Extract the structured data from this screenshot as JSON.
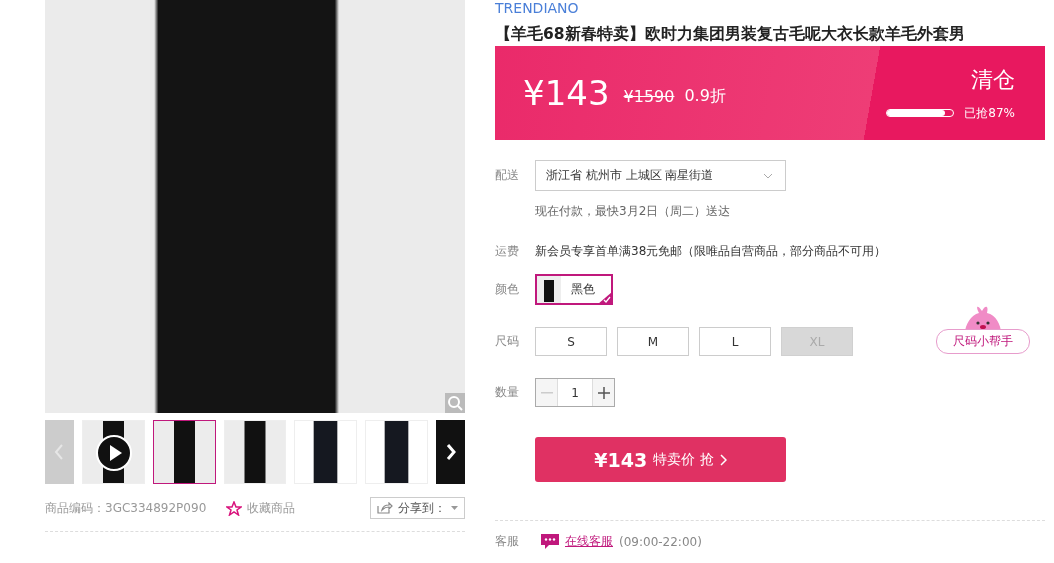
{
  "gallery": {
    "thumbnails": [
      {
        "kind": "video",
        "selected": false
      },
      {
        "kind": "photo",
        "selected": true
      },
      {
        "kind": "photo",
        "selected": false
      },
      {
        "kind": "product",
        "selected": false
      },
      {
        "kind": "product",
        "selected": false
      }
    ],
    "product_code": "商品编码：3GC334892P090",
    "favorite": "收藏商品",
    "share": "分享到："
  },
  "brand": "TRENDIANO",
  "title": "【羊毛68新春特卖】欧时力集团男装复古毛呢大衣长款羊毛外套男",
  "price_banner": {
    "price": "¥143",
    "original_price": "¥1590",
    "discount": "0.9折",
    "badge": "清仓",
    "level": 0.87,
    "sold": "已抢87%"
  },
  "delivery": {
    "label": "配送",
    "address": "浙江省 杭州市 上城区 南星街道",
    "note": "现在付款，最快3月2日（周二）送达"
  },
  "shipping": {
    "label": "运费",
    "text": "新会员专享首单满38元免邮（限唯品自营商品，部分商品不可用）"
  },
  "color": {
    "label": "颜色",
    "options": [
      {
        "label": "黑色",
        "selected": true
      }
    ]
  },
  "size": {
    "label": "尺码",
    "options": [
      {
        "label": "S",
        "disabled": false
      },
      {
        "label": "M",
        "disabled": false
      },
      {
        "label": "L",
        "disabled": false
      },
      {
        "label": "XL",
        "disabled": true
      }
    ],
    "helper": "尺码小帮手"
  },
  "quantity": {
    "label": "数量",
    "value": "1",
    "minus_disabled": true
  },
  "buy_button": {
    "price": "¥143",
    "label": "特卖价 抢"
  },
  "service": {
    "label": "客服",
    "link": "在线客服",
    "hours": "(09:00-22:00)"
  }
}
